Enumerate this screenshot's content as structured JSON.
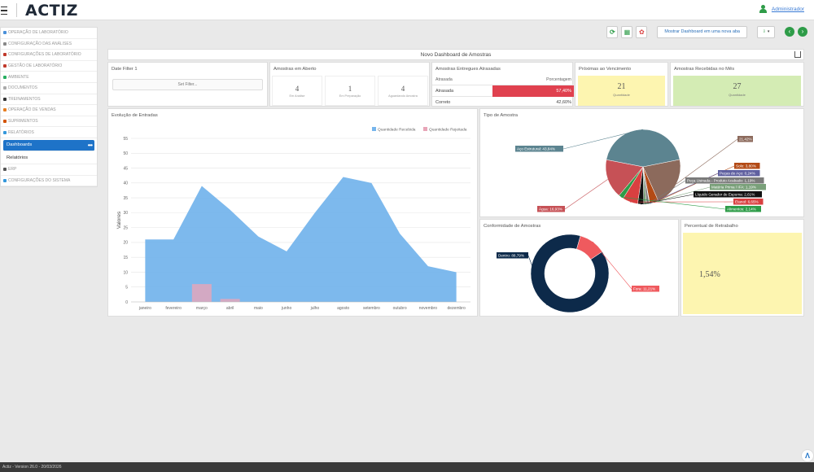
{
  "app": {
    "logo": "ACTIZ",
    "user": "Administrador",
    "footer": "Actiz - Version 26.0 - 20/03/2026"
  },
  "sidebar": {
    "items": [
      {
        "label": "OPERAÇÃO DE LABORATÓRIO",
        "color": "#4a90d9"
      },
      {
        "label": "CONFIGURAÇÃO DAS ANÁLISES",
        "color": "#888"
      },
      {
        "label": "CONFIGURAÇÕES DE LABORATÓRIO",
        "color": "#c0392b"
      },
      {
        "label": "GESTÃO DE LABORATÓRIO",
        "color": "#c0392b"
      },
      {
        "label": "AMBIENTE",
        "color": "#27ae60"
      },
      {
        "label": "DOCUMENTOS",
        "color": "#aaa"
      },
      {
        "label": "TREINAMENTOS",
        "color": "#333"
      },
      {
        "label": "OPERAÇÃO DE VENDAS",
        "color": "#e67e22"
      },
      {
        "label": "SUPRIMENTOS",
        "color": "#d35400"
      },
      {
        "label": "RELATÓRIOS",
        "color": "#3498db"
      }
    ],
    "sub": [
      {
        "label": "Dashboards",
        "dots": "•••"
      },
      {
        "label": "Relatórios"
      }
    ],
    "after": [
      {
        "label": "ERP",
        "color": "#555"
      },
      {
        "label": "CONFIGURAÇÕES DO SISTEMA",
        "color": "#3498db"
      }
    ]
  },
  "toolbar": {
    "new_tab": "Mostrar Dashboard em uma nova aba",
    "prev_icon": "arrow-left-icon",
    "next_icon": "arrow-right-icon"
  },
  "dashboard": {
    "title": "Novo Dashboard de Amostras",
    "date_filter": {
      "title": "Date Filter 1",
      "button": "Set Filter..."
    },
    "open_samples": {
      "title": "Amostras em Aberto",
      "kpis": [
        {
          "value": "4",
          "label": "Em Análise"
        },
        {
          "value": "1",
          "label": "Em Preparação"
        },
        {
          "value": "4",
          "label": "Aguardando Amostra"
        }
      ]
    },
    "late": {
      "title": "Amostras Entregues Atrasadas",
      "header": [
        "Atrasada",
        "Porcentagem"
      ],
      "rows": [
        {
          "label": "Atrasada",
          "value": "57,40%",
          "highlight": "#e0414f"
        },
        {
          "label": "Correto",
          "value": "42,60%"
        }
      ]
    },
    "due": {
      "title": "Próximas ao Vencimento",
      "value": "21",
      "label": "Quantidade",
      "bg": "#fdf5b0"
    },
    "month": {
      "title": "Amostras Recebidas no Mês",
      "value": "27",
      "label": "Quantidade",
      "bg": "#d4ecb4"
    },
    "evolution": {
      "title": "Evolução de Entradas"
    },
    "types": {
      "title": "Tipo de Amostra"
    },
    "conformity": {
      "title": "Conformidade de Amostras"
    },
    "rework": {
      "title": "Percentual de Retrabalho",
      "value": "1,54%",
      "bg": "#fdf5b0"
    }
  },
  "chart_data": [
    {
      "type": "area",
      "title": "Evolução de Entradas",
      "ylabel": "Valores",
      "ylim": [
        0,
        55
      ],
      "yticks": [
        0,
        5,
        10,
        15,
        20,
        25,
        30,
        35,
        40,
        45,
        50,
        55
      ],
      "categories": [
        "janeiro",
        "fevereiro",
        "março",
        "abril",
        "maio",
        "junho",
        "julho",
        "agosto",
        "setembro",
        "outubro",
        "novembro",
        "dezembro"
      ],
      "series": [
        {
          "name": "Quantidade Recebida",
          "color": "#76b5ec",
          "values": [
            21,
            21,
            39,
            31,
            22,
            17,
            30,
            42,
            40,
            23,
            12,
            10
          ]
        },
        {
          "name": "Quantidade Rejeitada",
          "color": "#e8a5b8",
          "values": [
            0,
            0,
            6,
            1,
            0,
            0,
            0,
            0,
            0,
            0,
            0,
            0
          ]
        }
      ]
    },
    {
      "type": "pie",
      "title": "Tipo de Amostra",
      "slices": [
        {
          "label": "Aço Estrutural",
          "value": 43.84,
          "display": "43,84%",
          "color": "#5c8490"
        },
        {
          "label": "",
          "value": 21.42,
          "display": "21,42%",
          "color": "#8c6a5c"
        },
        {
          "label": "Solo",
          "value": 3.8,
          "display": "3,80%",
          "color": "#b34a15"
        },
        {
          "label": "Peças de Aço",
          "value": 0.24,
          "display": "0,24%",
          "color": "#6060a0"
        },
        {
          "label": "Peça Usinada - Produto Acabado",
          "value": 1.19,
          "display": "1,19%",
          "color": "#7a7a7a"
        },
        {
          "label": "Matéria Prima / IFA",
          "value": 1.19,
          "display": "1,19%",
          "color": "#7aa07a"
        },
        {
          "label": "Líquido Gerador de Espuma",
          "value": 2.61,
          "display": "2,61%",
          "color": "#111111"
        },
        {
          "label": "Etanol",
          "value": 6.65,
          "display": "6,65%",
          "color": "#d94040"
        },
        {
          "label": "Alimentos",
          "value": 2.14,
          "display": "2,14%",
          "color": "#2e9c48"
        },
        {
          "label": "Água",
          "value": 16.93,
          "display": "16,93%",
          "color": "#c65156"
        }
      ]
    },
    {
      "type": "pie",
      "title": "Conformidade de Amostras",
      "slices": [
        {
          "label": "Dentro",
          "value": 88.79,
          "display": "88,79%",
          "color": "#0d2a4a"
        },
        {
          "label": "Fora",
          "value": 11.21,
          "display": "11,21%",
          "color": "#ef5a5e"
        }
      ]
    }
  ]
}
